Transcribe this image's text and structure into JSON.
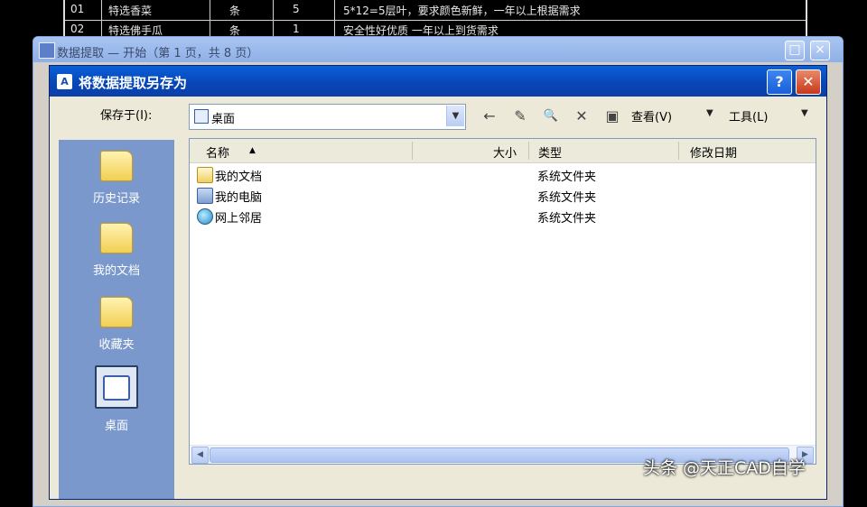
{
  "background_table": {
    "rows": [
      {
        "num": "01",
        "name": "特选香菜",
        "unit": "条",
        "qty": "5",
        "note": "5*12=5层叶，要求颜色新鲜，一年以上根据需求"
      },
      {
        "num": "02",
        "name": "特选佛手瓜",
        "unit": "条",
        "qty": "1",
        "note": "安全性好优质 一年以上到货需求"
      }
    ]
  },
  "parent_window": {
    "title": "数据提取 — 开始（第 1 页，共 8 页）",
    "buttons": {
      "maximize": "□",
      "close": "×"
    }
  },
  "dialog": {
    "title": "将数据提取另存为",
    "help_label": "?",
    "close_label": "✕",
    "save_in_label": "保存于(I):",
    "save_in_value": "桌面",
    "toolbar": {
      "back_icon": "←",
      "up_icon": "✎",
      "search_icon": "🔍",
      "delete_icon": "✕",
      "new_folder_icon": "▣",
      "view_label": "查看(V)",
      "tools_label": "工具(L)"
    },
    "places": [
      {
        "label": "历史记录",
        "icon": "history-folder-icon"
      },
      {
        "label": "我的文档",
        "icon": "my-documents-icon"
      },
      {
        "label": "收藏夹",
        "icon": "favorites-folder-icon"
      },
      {
        "label": "桌面",
        "icon": "desktop-icon",
        "selected": true
      }
    ],
    "columns": {
      "name": "名称",
      "size": "大小",
      "type": "类型",
      "modified": "修改日期"
    },
    "files": [
      {
        "name": "我的文档",
        "type": "系统文件夹",
        "icon": "my-documents-icon"
      },
      {
        "name": "我的电脑",
        "type": "系统文件夹",
        "icon": "my-computer-icon"
      },
      {
        "name": "网上邻居",
        "type": "系统文件夹",
        "icon": "network-icon"
      }
    ]
  },
  "watermark": "头条 @天正CAD自学"
}
